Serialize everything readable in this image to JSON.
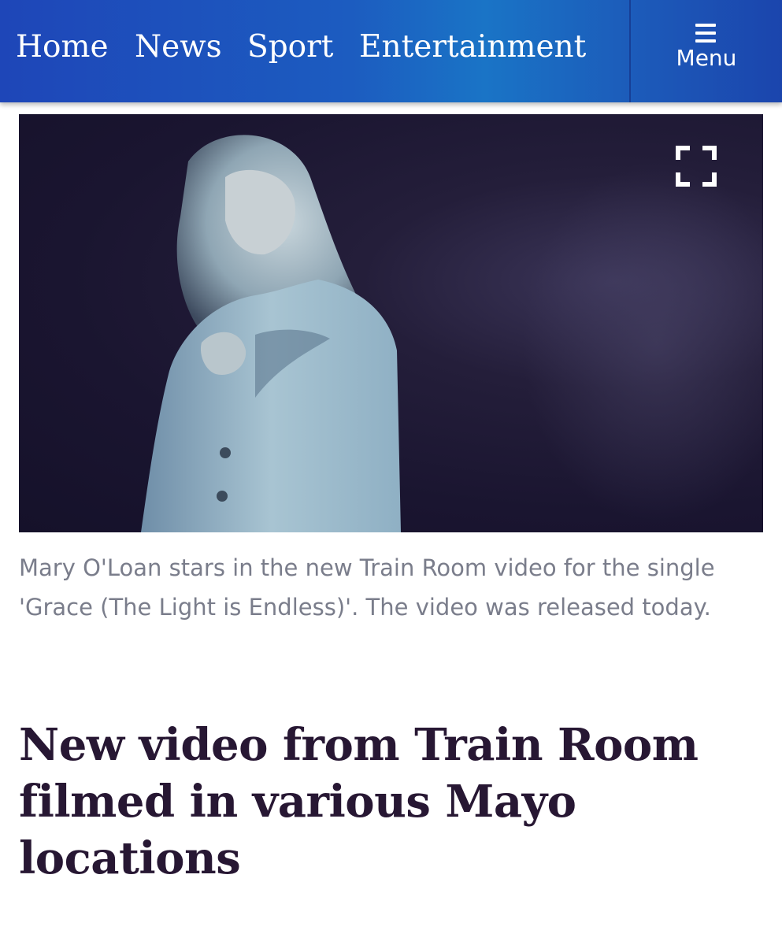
{
  "nav": {
    "items": [
      {
        "label": "Home"
      },
      {
        "label": "News"
      },
      {
        "label": "Sport"
      },
      {
        "label": "Entertainment"
      }
    ],
    "menu_label": "Menu",
    "menu_icon": "hamburger-icon"
  },
  "video": {
    "fullscreen_icon": "fullscreen-icon"
  },
  "article": {
    "caption": "Mary O'Loan stars in the new Train Room video for the single 'Grace (The Light is Endless)'. The video was released today.",
    "headline": "New video from Train Room filmed in various Mayo locations"
  },
  "colors": {
    "nav_blue": "#1c5cc0",
    "headline": "#271733",
    "caption": "#7a7d8b"
  }
}
